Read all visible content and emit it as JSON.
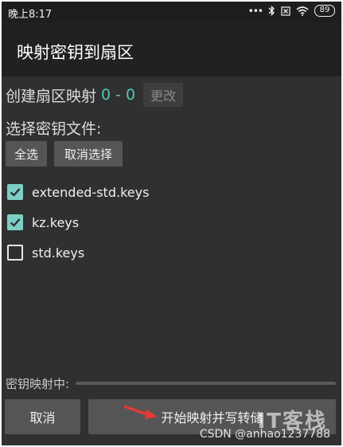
{
  "status_bar": {
    "time": "晚上8:17",
    "dots": "•••",
    "battery": "89",
    "icons": [
      "bluetooth-icon",
      "sim-x-icon",
      "wifi-icon",
      "battery-icon"
    ]
  },
  "title_bar": {
    "title": "映射密钥到扇区"
  },
  "map_row": {
    "label": "创建扇区映射",
    "range": "0 - 0",
    "change_label": "更改"
  },
  "select_label": "选择密钥文件:",
  "buttons": {
    "select_all": "全选",
    "deselect": "取消选择"
  },
  "files": [
    {
      "name": "extended-std.keys",
      "checked": true
    },
    {
      "name": "kz.keys",
      "checked": true
    },
    {
      "name": "std.keys",
      "checked": false
    }
  ],
  "progress": {
    "label": "密钥映射中:",
    "value_percent": 0
  },
  "bottom": {
    "cancel_label": "取消",
    "start_label": "开始映射并写转储"
  },
  "watermark": {
    "logo": "IT客栈",
    "text": "CSDN @anhao1237788"
  },
  "colors": {
    "accent": "#52c4b3",
    "check": "#7ccfc4",
    "arrow": "#e53935"
  }
}
